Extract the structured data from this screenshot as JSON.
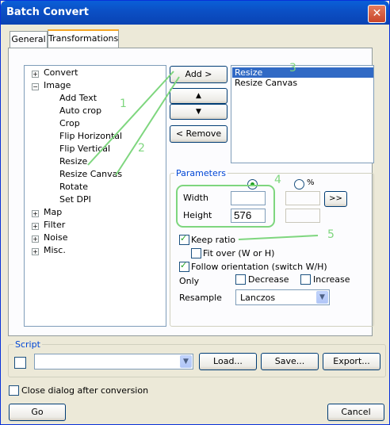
{
  "window": {
    "title": "Batch Convert",
    "close_glyph": "✕"
  },
  "tabs": [
    {
      "label": "General"
    },
    {
      "label": "Transformations"
    }
  ],
  "tree": {
    "items": [
      {
        "label": "Convert",
        "expander": "+"
      },
      {
        "label": "Image",
        "expander": "−"
      },
      {
        "label": "Add Text"
      },
      {
        "label": "Auto crop"
      },
      {
        "label": "Crop"
      },
      {
        "label": "Flip Horizontal"
      },
      {
        "label": "Flip Vertical"
      },
      {
        "label": "Resize"
      },
      {
        "label": "Resize Canvas"
      },
      {
        "label": "Rotate"
      },
      {
        "label": "Set DPI"
      },
      {
        "label": "Map",
        "expander": "+"
      },
      {
        "label": "Filter",
        "expander": "+"
      },
      {
        "label": "Noise",
        "expander": "+"
      },
      {
        "label": "Misc.",
        "expander": "+"
      }
    ]
  },
  "buttons": {
    "add": "Add >",
    "up": "▲",
    "down": "▼",
    "remove": "< Remove",
    "ratio": ">>",
    "load": "Load...",
    "save": "Save...",
    "export": "Export...",
    "go": "Go",
    "cancel": "Cancel"
  },
  "selected_list": {
    "items": [
      "Resize",
      "Resize Canvas"
    ],
    "selected": "Resize"
  },
  "parameters": {
    "group_label": "Parameters",
    "percent_label": "%",
    "width_label": "Width",
    "width_value": "",
    "height_label": "Height",
    "height_value": "576",
    "keep_ratio": "Keep ratio",
    "fit_over": "Fit over (W or H)",
    "follow_orientation": "Follow orientation (switch W/H)",
    "only_label": "Only",
    "decrease": "Decrease",
    "increase": "Increase",
    "resample_label": "Resample",
    "resample_value": "Lanczos"
  },
  "script": {
    "group_label": "Script",
    "value": ""
  },
  "close_after": "Close dialog after conversion",
  "annotations": [
    "1",
    "2",
    "3",
    "4",
    "5"
  ],
  "colors": {
    "annotation": "#7ed67e",
    "selection": "#316ac5",
    "title_bar": "#0a5fd8"
  }
}
